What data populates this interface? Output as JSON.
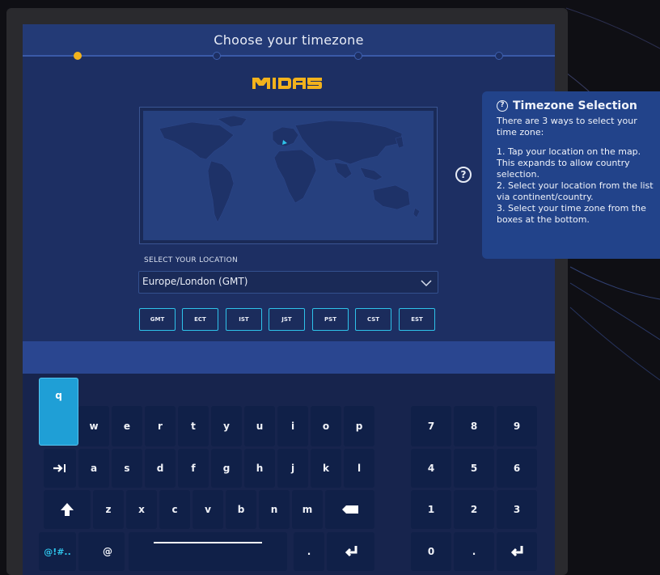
{
  "header": {
    "title": "Choose your timezone"
  },
  "brand": {
    "logo_text": "MIDAS",
    "accent": "#f2b21c"
  },
  "location": {
    "label": "SELECT YOUR LOCATION",
    "selected": "Europe/London (GMT)",
    "chevron_icon": "chevron-down-icon"
  },
  "timezones": [
    "GMT",
    "ECT",
    "IST",
    "JST",
    "PST",
    "CST",
    "EST"
  ],
  "help": {
    "icon_glyph": "?",
    "tooltip": {
      "title": "Timezone Selection",
      "intro": "There are 3 ways to select your time zone:",
      "step1": "1. Tap your location on the map. This expands to allow country selection.",
      "step2": "2. Select your location from the list via continent/country.",
      "step3": "3. Select your time zone from the boxes at the bottom."
    }
  },
  "keyboard": {
    "popup_key": "q",
    "row1": [
      "w",
      "e",
      "r",
      "t",
      "y",
      "u",
      "i",
      "o",
      "p"
    ],
    "row2": [
      "a",
      "s",
      "d",
      "f",
      "g",
      "h",
      "j",
      "k",
      "l"
    ],
    "row3": [
      "z",
      "x",
      "c",
      "v",
      "b",
      "n",
      "m"
    ],
    "symbols_key": "@!#..",
    "at_key": "@",
    "period_key": ".",
    "numpad": [
      "7",
      "8",
      "9",
      "4",
      "5",
      "6",
      "1",
      "2",
      "3",
      "0",
      "."
    ],
    "icons": {
      "tab": "tab-icon",
      "shift": "shift-arrow-icon",
      "backspace": "backspace-icon",
      "enter": "enter-icon"
    }
  },
  "colors": {
    "screen_bg": "#1d2f63",
    "titlebar": "#233a76",
    "tz_border": "#2ec3ea",
    "tooltip_bg": "#22438a"
  }
}
